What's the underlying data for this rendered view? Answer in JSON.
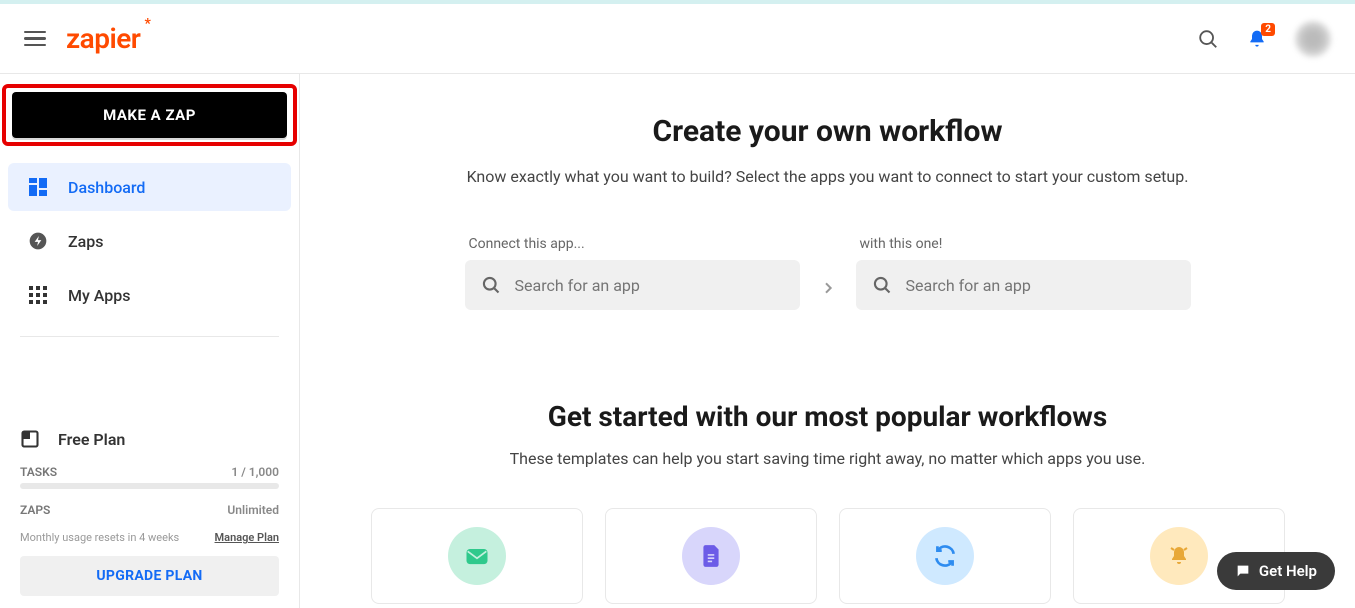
{
  "header": {
    "logo_text": "zapier",
    "notif_count": "2"
  },
  "sidebar": {
    "make_zap_label": "MAKE A ZAP",
    "nav": {
      "dashboard": "Dashboard",
      "zaps": "Zaps",
      "myapps": "My Apps"
    },
    "plan": {
      "name": "Free Plan",
      "tasks_label": "TASKS",
      "tasks_value": "1 / 1,000",
      "zaps_label": "ZAPS",
      "zaps_value": "Unlimited",
      "reset_text": "Monthly usage resets in 4 weeks",
      "manage_label": "Manage Plan",
      "upgrade_label": "UPGRADE PLAN"
    }
  },
  "main": {
    "hero_title": "Create your own workflow",
    "hero_sub": "Know exactly what you want to build? Select the apps you want to connect to start your custom setup.",
    "connect_label_1": "Connect this app...",
    "connect_label_2": "with this one!",
    "search_placeholder": "Search for an app",
    "popular_title": "Get started with our most popular workflows",
    "popular_sub": "These templates can help you start saving time right away, no matter which apps you use."
  },
  "help": {
    "label": "Get Help"
  }
}
